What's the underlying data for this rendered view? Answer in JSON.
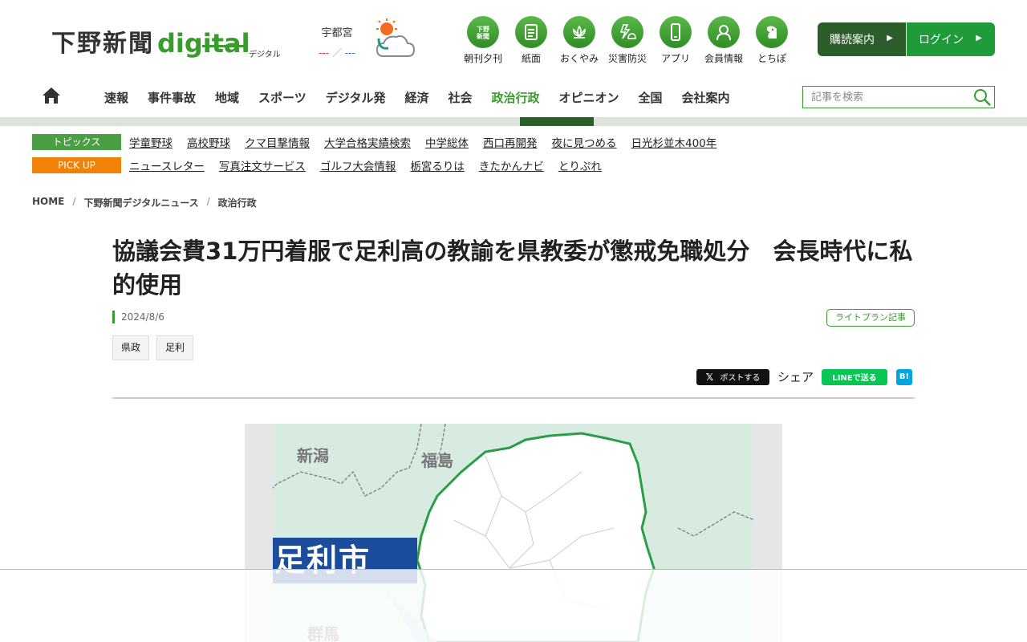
{
  "brand": {
    "logo_jp": "下野新聞",
    "logo_digital": "digital",
    "logo_sub": "デジタル",
    "accent": "#3a9b2f",
    "dark_green": "#2b5e2a"
  },
  "weather": {
    "city": "宇都宮",
    "temp_high": "---",
    "temp_sep": "／",
    "temp_low": "---",
    "icon": "sun-cloud-icon"
  },
  "icon_nav": [
    {
      "label": "朝刊夕刊",
      "icon": "newspaper-icon"
    },
    {
      "label": "紙面",
      "icon": "document-icon"
    },
    {
      "label": "おくやみ",
      "icon": "lotus-icon"
    },
    {
      "label": "災害防災",
      "icon": "disaster-icon"
    },
    {
      "label": "アプリ",
      "icon": "smartphone-icon"
    },
    {
      "label": "会員情報",
      "icon": "user-icon"
    },
    {
      "label": "とちぽ",
      "icon": "mascot-icon"
    }
  ],
  "header_buttons": {
    "subscribe": "購読案内",
    "login": "ログイン"
  },
  "main_nav": {
    "home_icon": "home-icon",
    "items": [
      "速報",
      "事件事故",
      "地域",
      "スポーツ",
      "デジタル発",
      "経済",
      "社会",
      "政治行政",
      "オピニオン",
      "全国",
      "会社案内"
    ],
    "active": "政治行政"
  },
  "search": {
    "placeholder": "記事を検索"
  },
  "topics": {
    "badge": "トピックス",
    "badge_color": "#4a9f45",
    "links": [
      "学童野球",
      "高校野球",
      "クマ目撃情報",
      "大学合格実績検索",
      "中学総体",
      "西口再開発",
      "夜に見つめる",
      "日光杉並木400年"
    ]
  },
  "pickup": {
    "badge": "PICK UP",
    "badge_color": "#f0820a",
    "links": [
      "ニュースレター",
      "写真注文サービス",
      "ゴルフ大会情報",
      "栃宮るりは",
      "きたかんナビ",
      "とりぷれ"
    ]
  },
  "breadcrumb": [
    "HOME",
    "下野新聞デジタルニュース",
    "政治行政"
  ],
  "article": {
    "title": "協議会費31万円着服で足利高の教諭を県教委が懲戒免職処分　会長時代に私的使用",
    "date": "2024/8/6",
    "plan_badge": "ライトプラン記事",
    "tags": [
      "県政",
      "足利"
    ]
  },
  "share": {
    "x_post": "ポストする",
    "share_label": "シェア",
    "line": "LINEで送る",
    "hatena": "B!"
  },
  "map": {
    "labels": {
      "niigata": "新潟",
      "fukushima": "福島",
      "gunma": "群馬"
    },
    "highlight": "足利市"
  }
}
